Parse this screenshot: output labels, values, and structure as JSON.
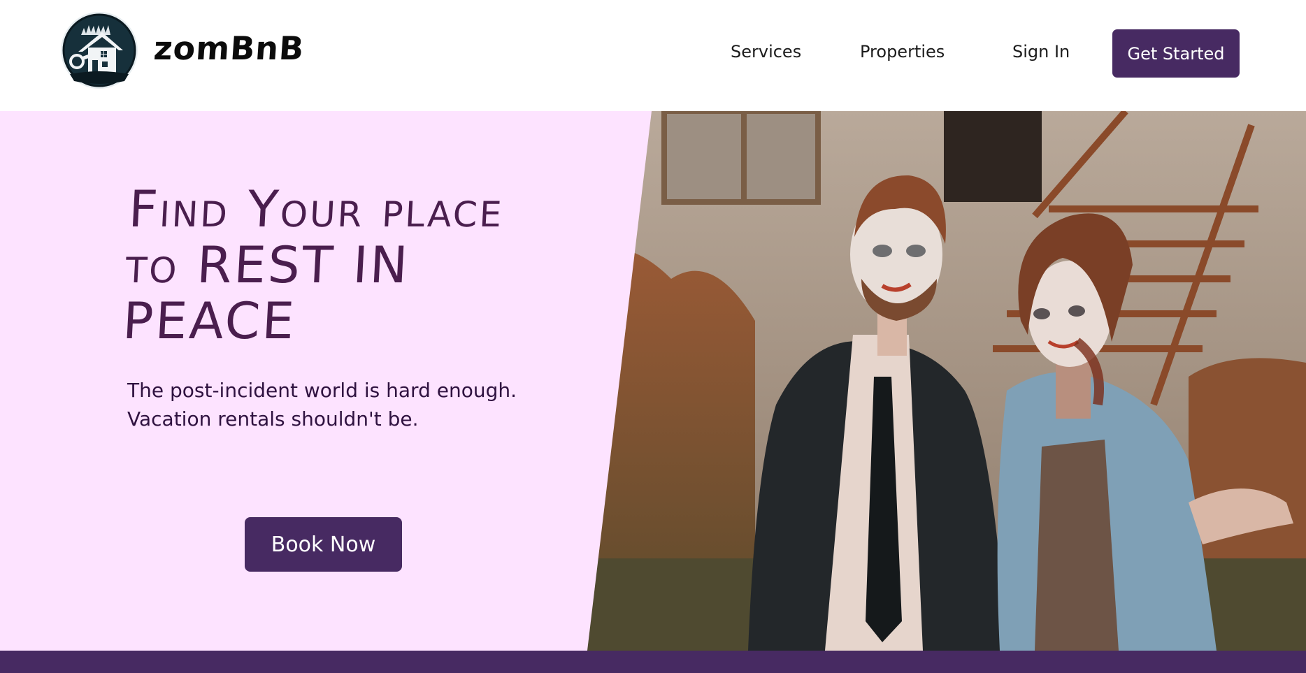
{
  "header": {
    "logo_icon": "haunted-house-key-icon",
    "brand_name": "zomBnB",
    "nav": {
      "services": "Services",
      "properties": "Properties",
      "sign_in": "Sign In"
    },
    "cta_label": "Get Started"
  },
  "hero": {
    "headline": "Find Your place to REST IN PEACE",
    "subtext_line1": "The post-incident world is hard enough.",
    "subtext_line2": "Vacation rentals shouldn't be.",
    "book_label": "Book Now",
    "photo_icon": "zombie-couple-photo"
  },
  "colors": {
    "brand_purple": "#472a62",
    "hero_pink": "#fde3ff",
    "headline_purple": "#4a1e4e"
  }
}
